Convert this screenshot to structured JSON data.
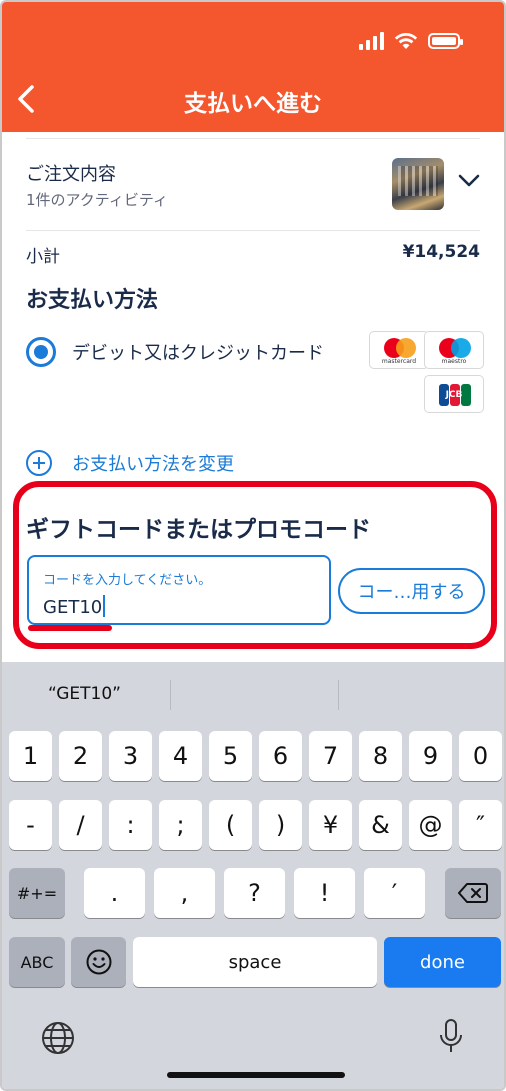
{
  "status_bar": {
    "icons": [
      "signal-icon",
      "wifi-icon",
      "battery-icon"
    ]
  },
  "header": {
    "title": "支払いへ進む",
    "back_icon": "chevron-left-icon",
    "color": "#f4562e"
  },
  "order": {
    "title": "ご注文内容",
    "subtitle": "1件のアクティビティ",
    "expand_icon": "chevron-down-icon"
  },
  "subtotal": {
    "label": "小計",
    "value": "¥14,524"
  },
  "payment": {
    "heading": "お支払い方法",
    "selected_option": "デビット又はクレジットカード",
    "card_brands": [
      "mastercard",
      "maestro",
      "JCB"
    ],
    "change_link": "お支払い方法を変更"
  },
  "promo": {
    "heading": "ギフトコードまたはプロモコード",
    "placeholder": "コードを入力してください。",
    "value": "GET10",
    "apply_label": "コー…用する",
    "highlight_color": "#e8001a"
  },
  "keyboard": {
    "suggestion": "“GET10”",
    "row1": [
      "1",
      "2",
      "3",
      "4",
      "5",
      "6",
      "7",
      "8",
      "9",
      "0"
    ],
    "row2": [
      "-",
      "/",
      ":",
      ";",
      "(",
      ")",
      "¥",
      "&",
      "@",
      "″"
    ],
    "row3_left": "#+=",
    "row3": [
      ".",
      ",",
      "?",
      "!",
      "′"
    ],
    "abc": "ABC",
    "space": "space",
    "done": "done"
  },
  "accent_color": "#1a7bd8"
}
